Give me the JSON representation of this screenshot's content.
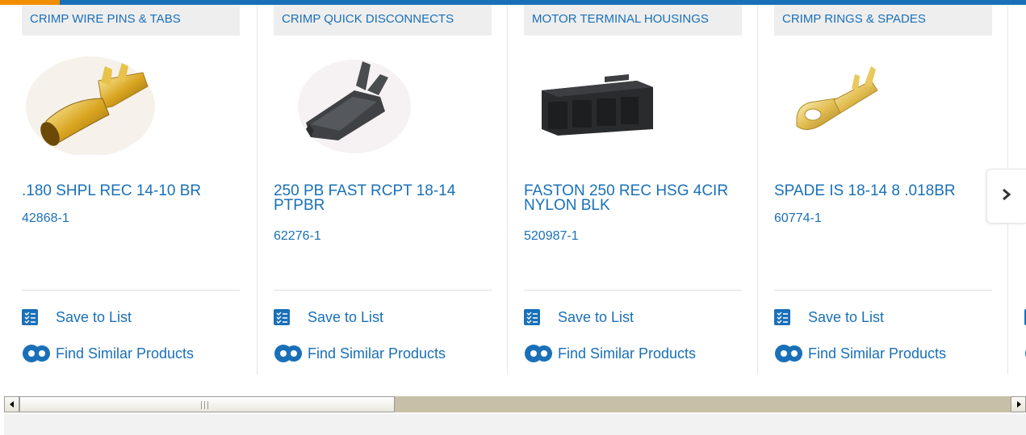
{
  "colors": {
    "brand_blue": "#1a70b8",
    "accent_orange": "#f28d00",
    "tag_bg": "#eeeeee"
  },
  "cards": [
    {
      "category": "CRIMP WIRE PINS & TABS",
      "title": ".180 SHPL REC 14-10 BR",
      "part_number": "42868-1",
      "image_icon": "crimp-pin-image"
    },
    {
      "category": "CRIMP QUICK DISCONNECTS",
      "title": "250 PB FAST RCPT 18-14 PTPBR",
      "part_number": "62276-1",
      "image_icon": "quick-disconnect-image"
    },
    {
      "category": "MOTOR TERMINAL HOUSINGS",
      "title": "FASTON 250 REC HSG 4CIR NYLON BLK",
      "part_number": "520987-1",
      "image_icon": "terminal-housing-image"
    },
    {
      "category": "CRIMP RINGS & SPADES",
      "title": "SPADE IS 18-14 8 .018BR",
      "part_number": "60774-1",
      "image_icon": "ring-spade-image"
    }
  ],
  "actions": {
    "save_label": "Save to List",
    "similar_label": "Find Similar Products"
  },
  "next_button": {
    "icon": "chevron-right-icon"
  }
}
